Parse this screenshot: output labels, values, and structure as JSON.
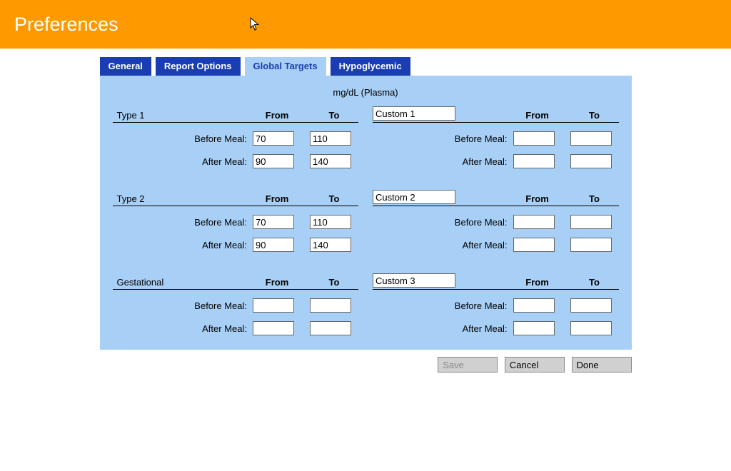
{
  "header": {
    "title": "Preferences"
  },
  "tabs": {
    "general": "General",
    "report_options": "Report Options",
    "global_targets": "Global Targets",
    "hypoglycemic": "Hypoglycemic"
  },
  "panel": {
    "unit_label": "mg/dL (Plasma)",
    "col_from": "From",
    "col_to": "To",
    "row_before": "Before Meal:",
    "row_after": "After Meal:"
  },
  "sections": {
    "type1": {
      "name": "Type 1",
      "before_from": "70",
      "before_to": "110",
      "after_from": "90",
      "after_to": "140"
    },
    "type2": {
      "name": "Type 2",
      "before_from": "70",
      "before_to": "110",
      "after_from": "90",
      "after_to": "140"
    },
    "gestational": {
      "name": "Gestational",
      "before_from": "",
      "before_to": "",
      "after_from": "",
      "after_to": ""
    },
    "custom1": {
      "name": "Custom 1",
      "before_from": "",
      "before_to": "",
      "after_from": "",
      "after_to": ""
    },
    "custom2": {
      "name": "Custom 2",
      "before_from": "",
      "before_to": "",
      "after_from": "",
      "after_to": ""
    },
    "custom3": {
      "name": "Custom 3",
      "before_from": "",
      "before_to": "",
      "after_from": "",
      "after_to": ""
    }
  },
  "footer": {
    "save": "Save",
    "cancel": "Cancel",
    "done": "Done"
  }
}
